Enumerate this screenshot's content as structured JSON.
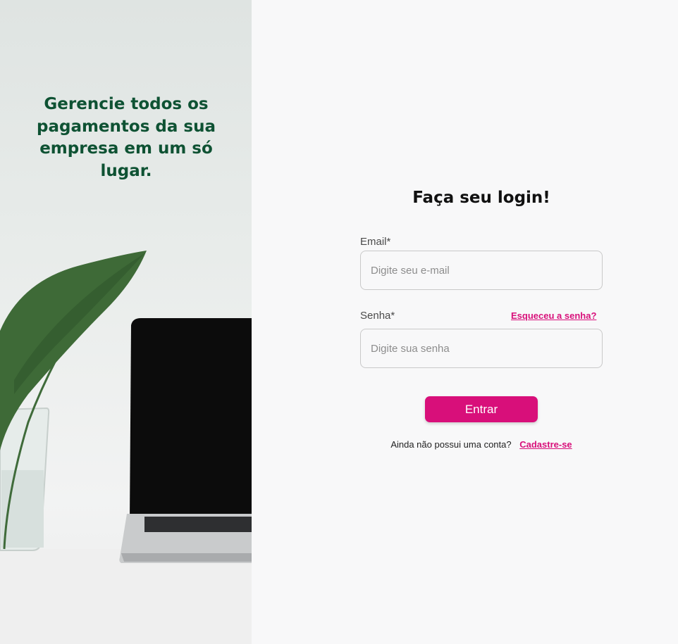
{
  "hero": {
    "tagline": "Gerencie todos os pagamentos da sua empresa em um só lugar."
  },
  "login": {
    "title": "Faça seu login!",
    "email_label": "Email*",
    "email_placeholder": "Digite seu e-mail",
    "password_label": "Senha*",
    "password_placeholder": "Digite sua senha",
    "forgot_password": "Esqueceu a senha?",
    "submit_label": "Entrar",
    "signup_prompt": "Ainda não possui uma conta?",
    "signup_link": "Cadastre-se"
  },
  "colors": {
    "accent": "#d80f7a",
    "tagline": "#0e5233",
    "background": "#f8f8f9"
  },
  "icons": {
    "hero_image": "laptop-plant-illustration"
  }
}
